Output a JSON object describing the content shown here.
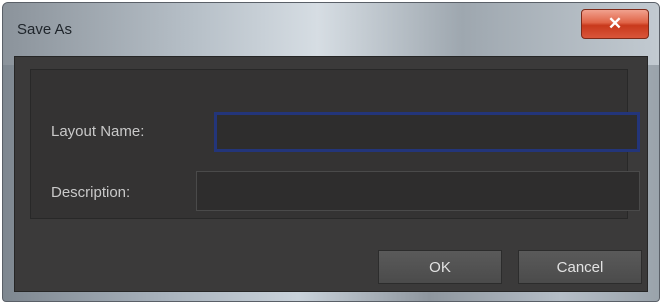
{
  "window": {
    "title": "Save As",
    "close_glyph": "✕"
  },
  "form": {
    "layout_name_label": "Layout Name:",
    "layout_name_value": "",
    "description_label": "Description:",
    "description_value": ""
  },
  "buttons": {
    "ok_label": "OK",
    "cancel_label": "Cancel"
  },
  "colors": {
    "dialog_background": "#3b3a3a",
    "focus_border": "#23357a",
    "close_button": "#d9553a"
  },
  "icons": {
    "close": "close-icon"
  }
}
